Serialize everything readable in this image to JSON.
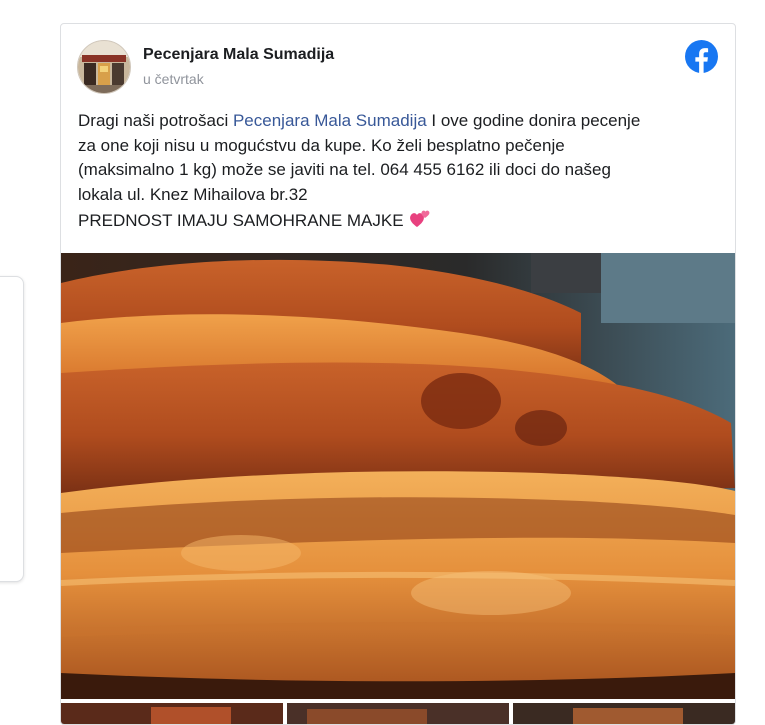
{
  "post": {
    "author": "Pecenjara Mala Sumadija",
    "timestamp": "u četvrtak",
    "text": {
      "line1_prefix": "Dragi naši potrošaci ",
      "mention": "Pecenjara Mala Sumadija",
      "line1_suffix": " I ove godine donira pecenje",
      "line2": "za one koji nisu u mogućstvu da kupe. Ko želi besplatno pečenje",
      "line3": "(maksimalno 1 kg) može se javiti na tel. 064 455 6162 ili doci do našeg",
      "line4": "lokala ul. Knez Mihailova br.32",
      "line5": "PREDNOST IMAJU SAMOHRANE MAJKE"
    },
    "icons": {
      "platform": "facebook-icon",
      "emoji": "two-hearts-icon"
    }
  },
  "colors": {
    "link": "#385898",
    "facebook": "#1877f2",
    "heart": "#e8417f"
  }
}
